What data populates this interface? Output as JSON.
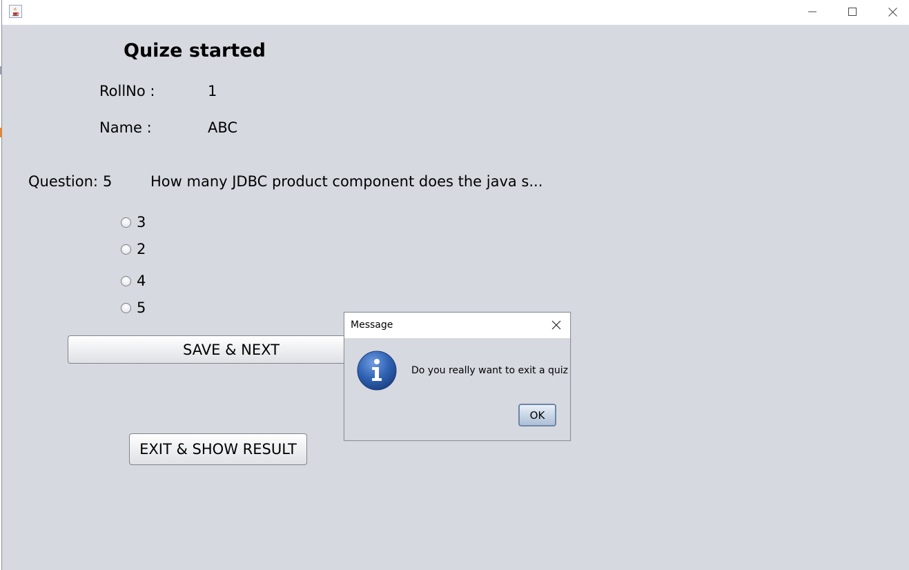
{
  "window": {
    "app_icon": "java-cup-icon",
    "controls": [
      "minimize-icon",
      "maximize-icon",
      "close-icon"
    ]
  },
  "main": {
    "heading": "Quize started",
    "rollno_label": "RollNo :",
    "rollno_value": "1",
    "name_label": "Name :",
    "name_value": "ABC",
    "question_label": "Question:",
    "question_number": "5",
    "question_text": "How many JDBC product component does the java s...",
    "options": [
      "3",
      "2",
      "4",
      "5"
    ],
    "save_next_label": "SAVE & NEXT",
    "exit_label": "EXIT & SHOW RESULT"
  },
  "dialog": {
    "title": "Message",
    "message": "Do you really want to exit a quiz",
    "ok_label": "OK",
    "icon": "info-icon"
  },
  "colors": {
    "content_bg": "#d6d9e0",
    "info_blue": "#2f62b3"
  }
}
